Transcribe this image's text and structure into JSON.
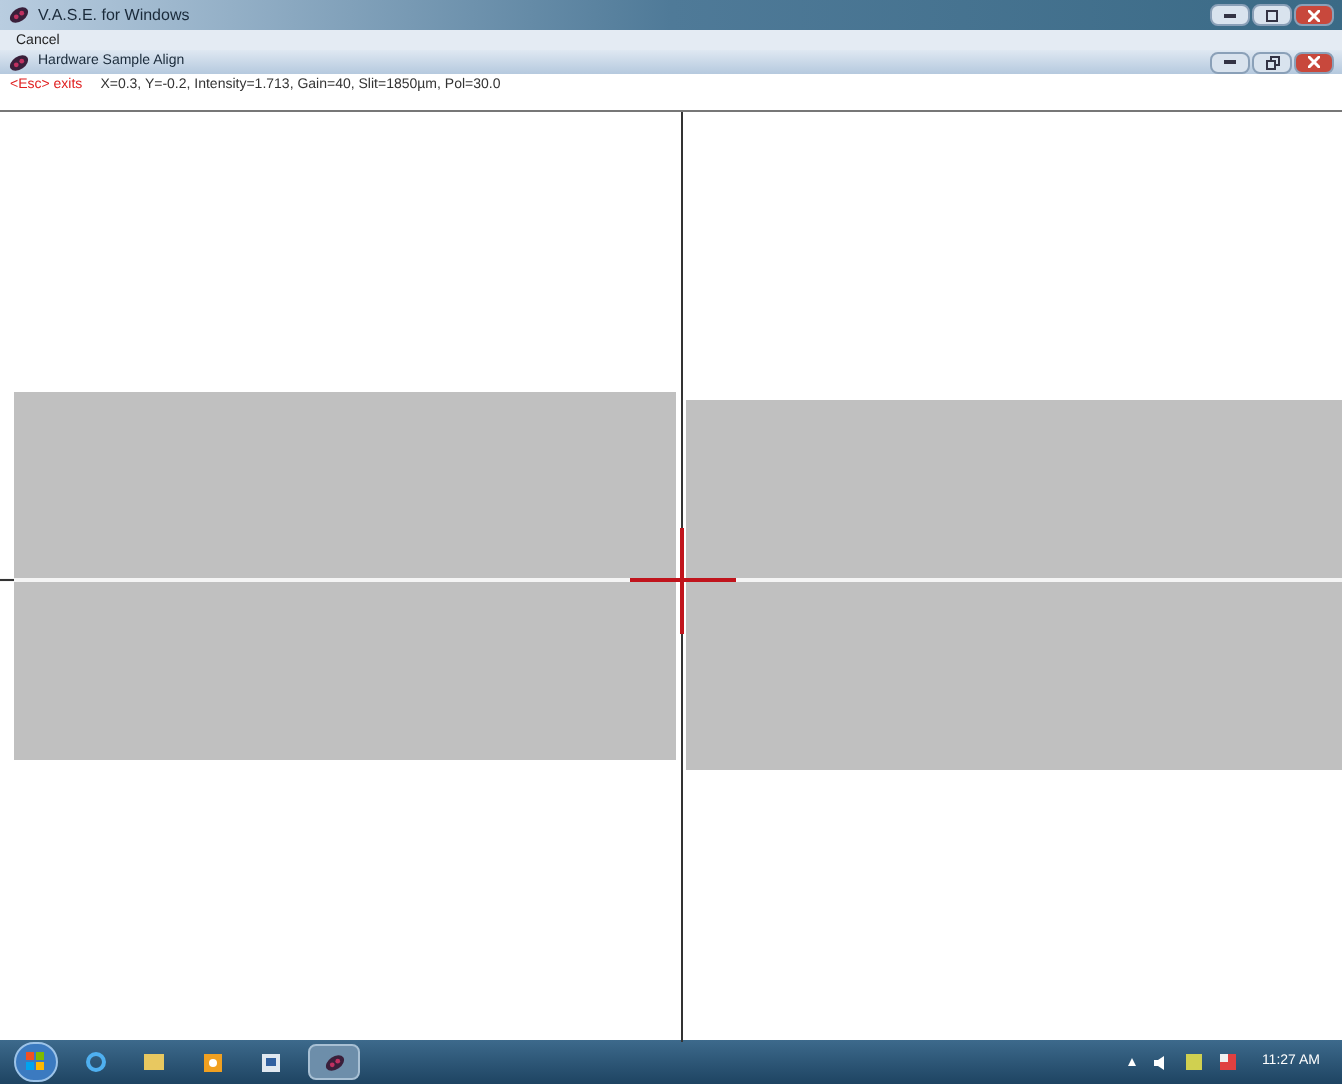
{
  "window": {
    "title": "V.A.S.E. for Windows"
  },
  "menu": {
    "items": [
      {
        "label": "Cancel"
      }
    ]
  },
  "child_window": {
    "title": "Hardware Sample Align"
  },
  "status": {
    "hint": "<Esc> exits",
    "readout": "X=0.3, Y=-0.2, Intensity=1.713, Gain=40, Slit=1850µm, Pol=30.0"
  },
  "taskbar": {
    "clock": "11:27 AM"
  }
}
